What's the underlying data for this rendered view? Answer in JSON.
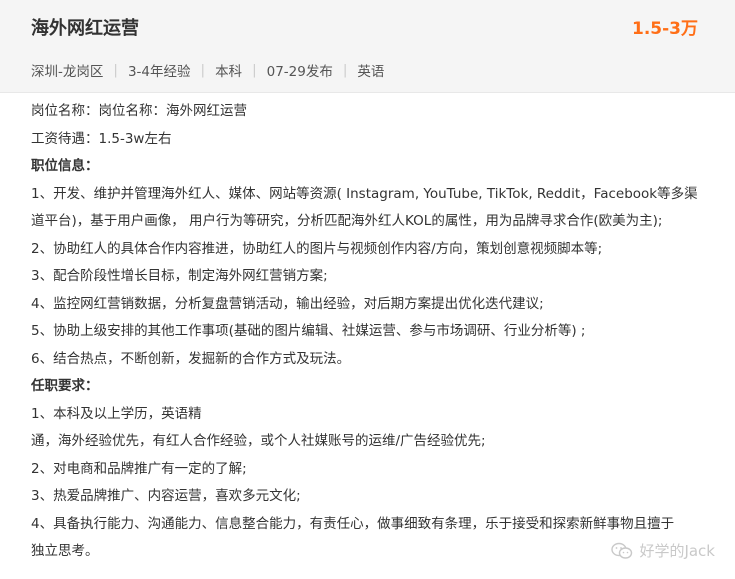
{
  "header": {
    "title": "海外网红运营",
    "salary": "1.5-3万",
    "meta": [
      "深圳-龙岗区",
      "3-4年经验",
      "本科",
      "07-29发布",
      "英语"
    ]
  },
  "content": {
    "lines": [
      {
        "text": "岗位名称：岗位名称：海外网红运营",
        "bold": false
      },
      {
        "text": "工资待遇：1.5-3w左右",
        "bold": false
      },
      {
        "text": "职位信息：",
        "bold": true
      },
      {
        "text": "1、开发、维护并管理海外红人、媒体、网站等资源( Instagram, YouTube, TikTok, Reddit，Facebook等多渠",
        "bold": false
      },
      {
        "text": "道平台)，基于用户画像， 用户行为等研究，分析匹配海外红人KOL的属性，用为品牌寻求合作(欧美为主);",
        "bold": false
      },
      {
        "text": "2、协助红人的具体合作内容推进，协助红人的图片与视频创作内容/方向，策划创意视频脚本等;",
        "bold": false
      },
      {
        "text": "3、配合阶段性增长目标，制定海外网红营销方案;",
        "bold": false
      },
      {
        "text": "4、监控网红营销数据，分析复盘营销活动，输出经验，对后期方案提出优化迭代建议;",
        "bold": false
      },
      {
        "text": "5、协助上级安排的其他工作事项(基础的图片编辑、社媒运营、参与市场调研、行业分析等) ;",
        "bold": false
      },
      {
        "text": "6、结合热点，不断创新，发掘新的合作方式及玩法。",
        "bold": false
      },
      {
        "text": "任职要求：",
        "bold": true
      },
      {
        "text": "1、本科及以上学历，英语精",
        "bold": false
      },
      {
        "text": "通，海外经验优先，有红人合作经验，或个人社媒账号的运维/广告经验优先;",
        "bold": false
      },
      {
        "text": "2、对电商和品牌推广有一定的了解;",
        "bold": false
      },
      {
        "text": "3、热爱品牌推广、内容运营，喜欢多元文化;",
        "bold": false
      },
      {
        "text": "4、具备执行能力、沟通能力、信息整合能力，有责任心，做事细致有条理，乐于接受和探索新鲜事物且擅于",
        "bold": false
      },
      {
        "text": "独立思考。",
        "bold": false
      }
    ]
  },
  "watermark": {
    "text": "好学的Jack",
    "icon": "wechat-icon"
  }
}
